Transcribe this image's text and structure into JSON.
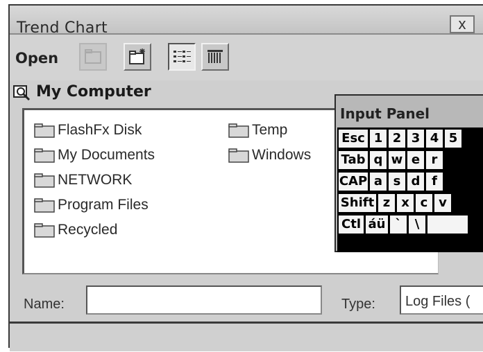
{
  "window": {
    "title": "Trend Chart",
    "close_label": "x"
  },
  "toolbar": {
    "open_label": "Open",
    "buttons": [
      {
        "icon": "up-folder-icon",
        "state": "disabled"
      },
      {
        "icon": "new-folder-icon",
        "state": "raised"
      },
      {
        "icon": "list-view-icon",
        "state": "pressed"
      },
      {
        "icon": "details-view-icon",
        "state": "raised"
      }
    ]
  },
  "location": {
    "label": "My Computer"
  },
  "files": [
    {
      "name": "FlashFx Disk"
    },
    {
      "name": "My Documents"
    },
    {
      "name": "NETWORK"
    },
    {
      "name": "Program Files"
    },
    {
      "name": "Recycled"
    },
    {
      "name": "Temp"
    },
    {
      "name": "Windows"
    }
  ],
  "name_field": {
    "label": "Name:",
    "value": ""
  },
  "type_field": {
    "label": "Type:",
    "value": "Log Files ("
  },
  "input_panel": {
    "title": "Input Panel",
    "rows": [
      [
        "Esc",
        "1",
        "2",
        "3",
        "4",
        "5"
      ],
      [
        "Tab",
        "q",
        "w",
        "e",
        "r"
      ],
      [
        "CAP",
        "a",
        "s",
        "d",
        "f"
      ],
      [
        "Shift",
        "z",
        "x",
        "c",
        "v"
      ],
      [
        "Ctl",
        "áü",
        "`",
        "\\",
        ""
      ]
    ]
  }
}
